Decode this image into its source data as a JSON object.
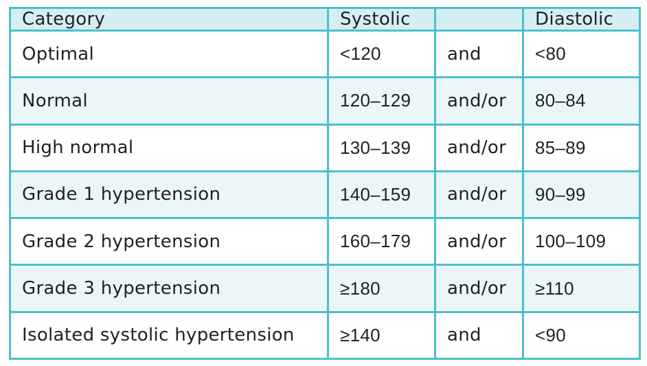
{
  "table": {
    "headers": [
      "Category",
      "Systolic",
      "",
      "Diastolic"
    ],
    "rows": [
      {
        "category": "Optimal",
        "systolic": "<120",
        "conjunction": "and",
        "diastolic": "<80"
      },
      {
        "category": "Normal",
        "systolic": "120–129",
        "conjunction": "and/or",
        "diastolic": "80–84"
      },
      {
        "category": "High normal",
        "systolic": "130–139",
        "conjunction": "and/or",
        "diastolic": "85–89"
      },
      {
        "category": "Grade 1 hypertension",
        "systolic": "140–159",
        "conjunction": "and/or",
        "diastolic": "90–99"
      },
      {
        "category": "Grade 2 hypertension",
        "systolic": "160–179",
        "conjunction": "and/or",
        "diastolic": "100–109"
      },
      {
        "category": "Grade 3 hypertension",
        "systolic": "≥180",
        "conjunction": "and/or",
        "diastolic": "≥110"
      },
      {
        "category": "Isolated systolic hypertension",
        "systolic": "≥140",
        "conjunction": "and",
        "diastolic": "<90"
      }
    ]
  },
  "colors": {
    "border": "#4bbfcc",
    "header_bg": "#d5eef2",
    "alt_row_bg": "#ebf6f9",
    "text": "#231f20"
  }
}
